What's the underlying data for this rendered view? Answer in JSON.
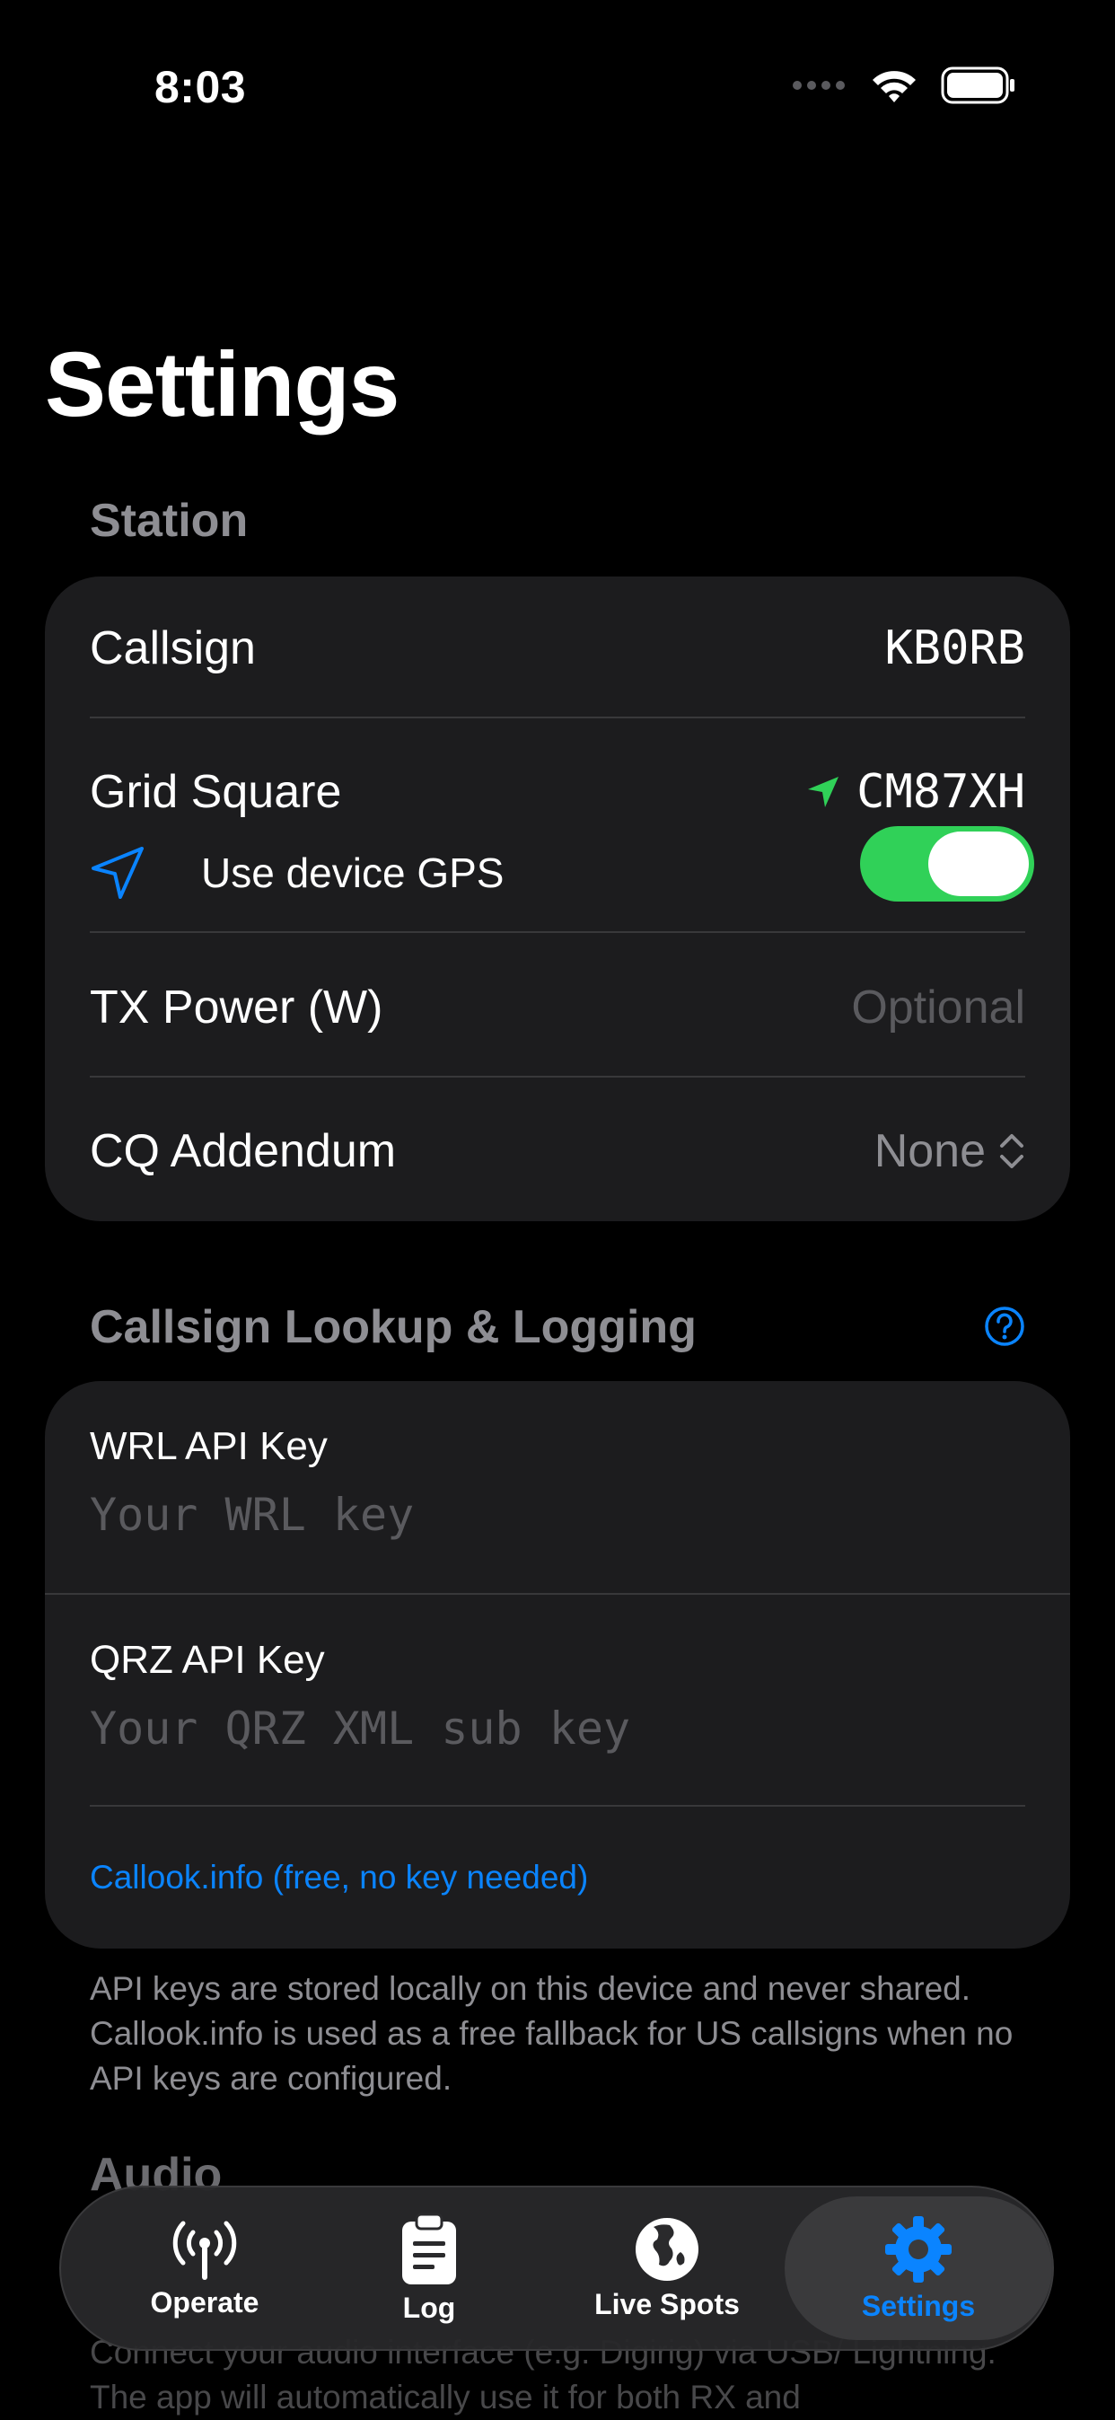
{
  "status_bar": {
    "time": "8:03"
  },
  "page": {
    "title": "Settings"
  },
  "station": {
    "header": "Station",
    "callsign": {
      "label": "Callsign",
      "value": "KB0RB"
    },
    "grid_square": {
      "label": "Grid Square",
      "value": "CM87XH",
      "gps_label": "Use device GPS",
      "gps_enabled": true
    },
    "tx_power": {
      "label": "TX Power (W)",
      "placeholder": "Optional"
    },
    "cq_addendum": {
      "label": "CQ Addendum",
      "value": "None"
    }
  },
  "lookup": {
    "header": "Callsign Lookup & Logging",
    "wrl": {
      "label": "WRL API Key",
      "placeholder": "Your WRL key"
    },
    "qrz": {
      "label": "QRZ API Key",
      "placeholder": "Your QRZ XML sub key"
    },
    "callook_link": "Callook.info (free, no key needed)",
    "footer": "API keys are stored locally on this device and never shared. Callook.info is used as a free fallback for US callsigns when no API keys are configured."
  },
  "audio": {
    "header": "Audio",
    "description": "Connect your audio interface (e.g. Digirig) via USB/ Lightning. The app will automatically use it for both RX and"
  },
  "tabbar": {
    "tabs": [
      {
        "label": "Operate",
        "icon": "antenna-icon"
      },
      {
        "label": "Log",
        "icon": "clipboard-icon"
      },
      {
        "label": "Live Spots",
        "icon": "globe-icon"
      },
      {
        "label": "Settings",
        "icon": "gear-icon"
      }
    ],
    "selected": "Settings"
  },
  "colors": {
    "accent": "#0a84ff",
    "toggle_on": "#30d158",
    "location_arrow": "#30d158",
    "card": "#1c1c1e"
  }
}
